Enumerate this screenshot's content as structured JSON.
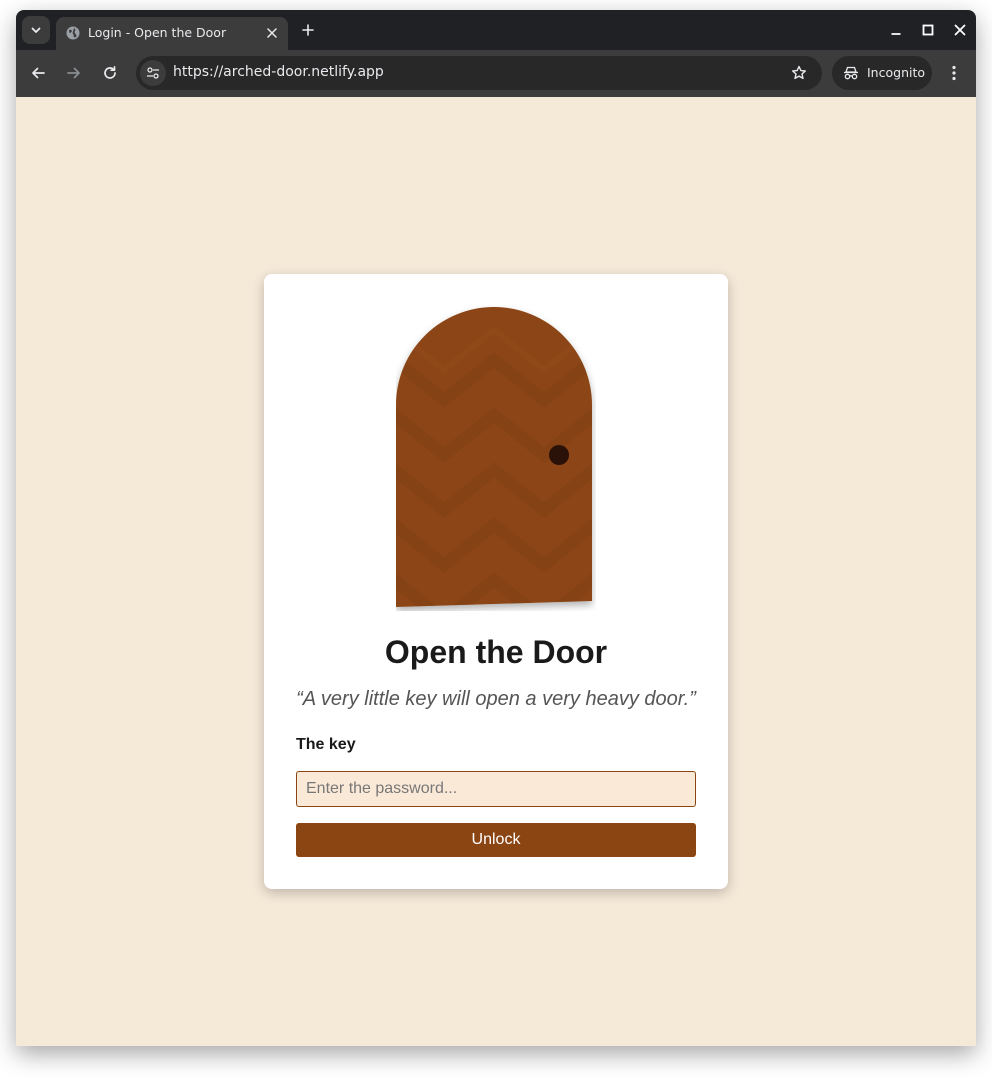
{
  "browser": {
    "tab": {
      "title": "Login - Open the Door"
    },
    "url": "https://arched-door.netlify.app",
    "profile_label": "Incognito"
  },
  "card": {
    "title": "Open the Door",
    "quote": "“A very little key will open a very heavy door.”",
    "field_label": "The key",
    "password_placeholder": "Enter the password...",
    "submit_label": "Unlock"
  },
  "colors": {
    "page_background": "#f5e9d8",
    "door": "#8b4513",
    "accent": "#8b4513",
    "input_background": "#fbe9d7"
  }
}
